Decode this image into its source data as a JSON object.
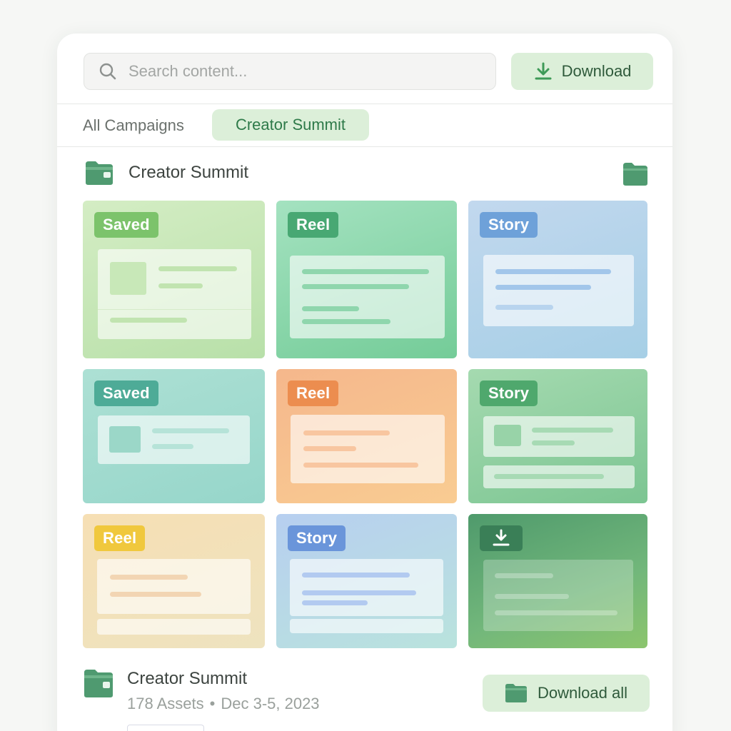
{
  "search": {
    "placeholder": "Search content..."
  },
  "toolbar": {
    "download_label": "Download"
  },
  "tabs": [
    {
      "label": "All Campaigns",
      "active": false
    },
    {
      "label": "Creator Summit",
      "active": true
    }
  ],
  "section": {
    "title": "Creator Summit"
  },
  "grid": {
    "cards": [
      {
        "badge": "Saved",
        "theme": "green"
      },
      {
        "badge": "Reel",
        "theme": "emerald"
      },
      {
        "badge": "Story",
        "theme": "blue"
      },
      {
        "badge": "Saved",
        "theme": "teal"
      },
      {
        "badge": "Reel",
        "theme": "orange"
      },
      {
        "badge": "Story",
        "theme": "green"
      },
      {
        "badge": "Reel",
        "theme": "yellow"
      },
      {
        "badge": "Story",
        "theme": "blue"
      },
      {
        "badge": "",
        "theme": "dark-green",
        "icon": "download-icon"
      }
    ]
  },
  "footer": {
    "title": "Creator Summit",
    "assets": "178 Assets",
    "separator": "•",
    "dates": "Dec 3-5, 2023",
    "download_all_label": "Download all"
  },
  "colors": {
    "accent": "#2e7a49",
    "accent_bg": "#dcefd9",
    "folder": "#4f9a70"
  }
}
